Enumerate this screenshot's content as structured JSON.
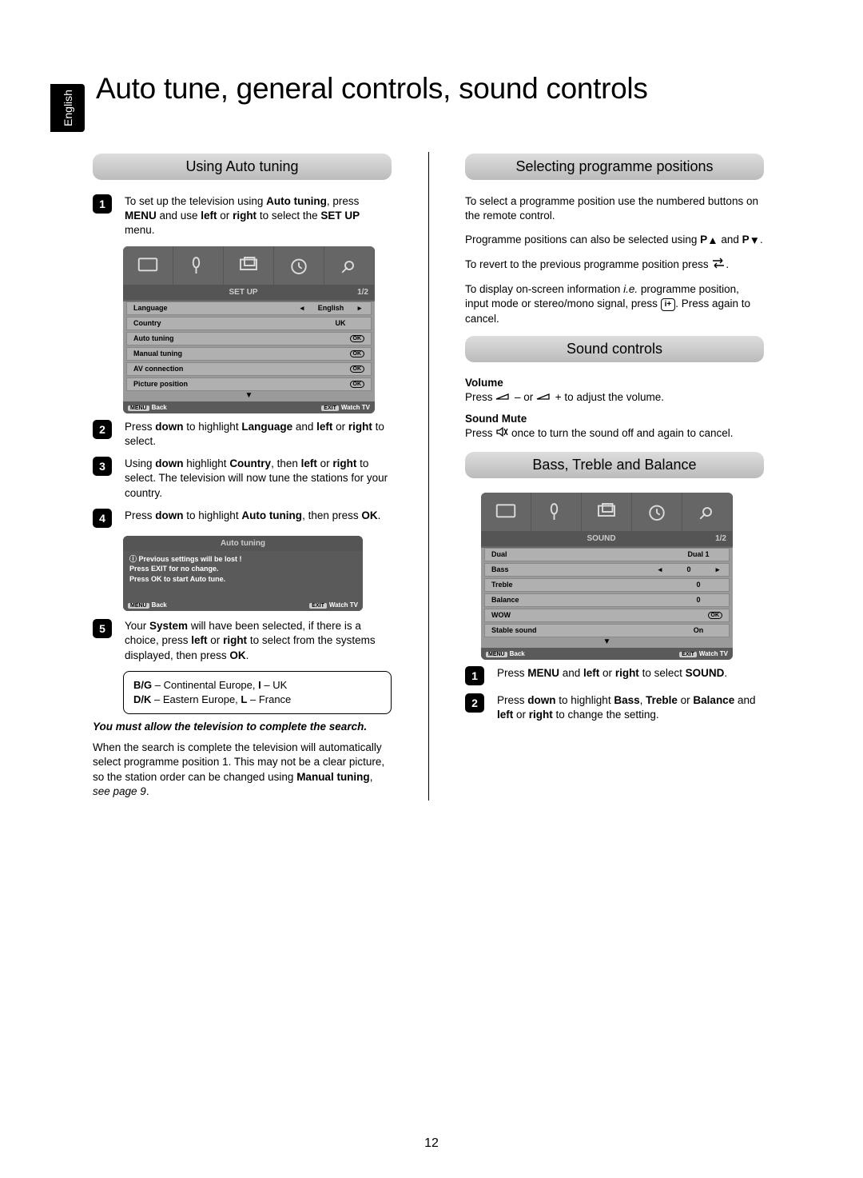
{
  "lang_tab": "English",
  "title": "Auto tune, general controls, sound controls",
  "left": {
    "heading1": "Using Auto tuning",
    "step1_a": "To set up the television using ",
    "step1_b": "Auto tuning",
    "step1_c": ", press ",
    "step1_d": "MENU",
    "step1_e": " and use ",
    "step1_f": "left",
    "step1_g": " or ",
    "step1_h": "right",
    "step1_i": " to select the ",
    "step1_j": "SET UP",
    "step1_k": " menu.",
    "osd1": {
      "title": "SET UP",
      "page": "1/2",
      "rows": [
        {
          "label": "Language",
          "value": "English",
          "arrows": true
        },
        {
          "label": "Country",
          "value": "UK"
        },
        {
          "label": "Auto tuning",
          "ok": true
        },
        {
          "label": "Manual tuning",
          "ok": true
        },
        {
          "label": "AV connection",
          "ok": true
        },
        {
          "label": "Picture position",
          "ok": true
        }
      ],
      "menu": "MENU",
      "back": "Back",
      "exit": "EXIT",
      "watch": "Watch TV"
    },
    "step2_a": "Press ",
    "step2_b": "down",
    "step2_c": " to highlight ",
    "step2_d": "Language",
    "step2_e": " and ",
    "step2_f": "left",
    "step2_g": " or ",
    "step2_h": "right",
    "step2_i": " to select.",
    "step3_a": "Using ",
    "step3_b": "down",
    "step3_c": " highlight ",
    "step3_d": "Country",
    "step3_e": ", then ",
    "step3_f": "left",
    "step3_g": " or ",
    "step3_h": "right",
    "step3_i": " to select. The television will now tune the stations for your country.",
    "step4_a": "Press ",
    "step4_b": "down",
    "step4_c": " to highlight ",
    "step4_d": "Auto tuning",
    "step4_e": ", then press ",
    "step4_f": "OK",
    "step4_g": ".",
    "osd2": {
      "title": "Auto tuning",
      "line1": "Previous settings will be lost  !",
      "line2": "Press EXIT for no change.",
      "line3": "Press OK to start Auto tune.",
      "menu": "MENU",
      "back": "Back",
      "exit": "EXIT",
      "watch": "Watch TV"
    },
    "step5_a": "Your ",
    "step5_b": "System",
    "step5_c": " will have been selected, if there is a choice, press ",
    "step5_d": "left",
    "step5_e": " or ",
    "step5_f": "right",
    "step5_g": " to select from the systems displayed, then press ",
    "step5_h": "OK",
    "step5_i": ".",
    "notebox_a": "B/G",
    "notebox_b": " – Continental Europe, ",
    "notebox_c": "I",
    "notebox_d": " – UK",
    "notebox_e": "D/K",
    "notebox_f": " – Eastern Europe, ",
    "notebox_g": "L",
    "notebox_h": " – France",
    "italic": "You must allow the television to complete the search.",
    "closing_a": "When the search is complete the television will automatically select programme position 1. This may not be a clear picture, so the station order can be changed using ",
    "closing_b": "Manual tuning",
    "closing_c": ", ",
    "closing_d": "see page 9",
    "closing_e": "."
  },
  "right": {
    "heading1": "Selecting programme positions",
    "p1": "To select a programme position use the numbered buttons on the remote control.",
    "p2_a": "Programme positions can also be selected using ",
    "p2_b": "P",
    "p2_c": " and ",
    "p2_d": "P",
    "p2_e": ".",
    "p3_a": "To revert to the previous programme position press ",
    "p3_b": ".",
    "p4_a": "To display on-screen information ",
    "p4_b": "i.e.",
    "p4_c": " programme position, input mode or stereo/mono signal, press ",
    "p4_d": ". Press again to cancel.",
    "heading2": "Sound controls",
    "sub1": "Volume",
    "sub1p_a": "Press ",
    "sub1p_b": " – or ",
    "sub1p_c": " + to adjust the volume.",
    "sub2": "Sound Mute",
    "sub2p_a": "Press ",
    "sub2p_b": " once to turn the sound off and again to cancel.",
    "heading3": "Bass, Treble and Balance",
    "osd": {
      "title": "SOUND",
      "page": "1/2",
      "rows": [
        {
          "label": "Dual",
          "value": "Dual 1"
        },
        {
          "label": "Bass",
          "value": "0",
          "arrows": true
        },
        {
          "label": "Treble",
          "value": "0"
        },
        {
          "label": "Balance",
          "value": "0"
        },
        {
          "label": "WOW",
          "ok": true
        },
        {
          "label": "Stable sound",
          "value": "On"
        }
      ],
      "menu": "MENU",
      "back": "Back",
      "exit": "EXIT",
      "watch": "Watch TV"
    },
    "step1_a": "Press ",
    "step1_b": "MENU",
    "step1_c": " and ",
    "step1_d": "left",
    "step1_e": " or ",
    "step1_f": "right",
    "step1_g": " to select ",
    "step1_h": "SOUND",
    "step1_i": ".",
    "step2_a": "Press ",
    "step2_b": "down",
    "step2_c": " to highlight ",
    "step2_d": "Bass",
    "step2_e": ", ",
    "step2_f": "Treble",
    "step2_g": " or ",
    "step2_h": "Balance",
    "step2_i": " and ",
    "step2_j": "left",
    "step2_k": " or ",
    "step2_l": "right",
    "step2_m": " to change the setting."
  },
  "page_number": "12"
}
